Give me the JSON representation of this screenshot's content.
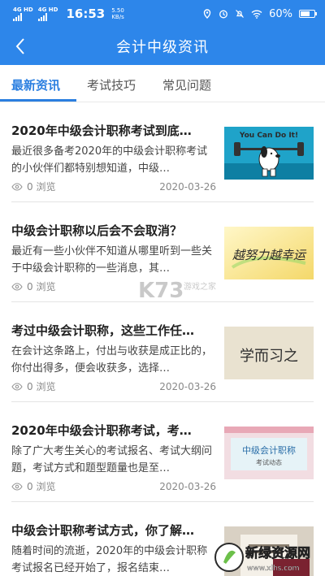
{
  "status_bar": {
    "network_1": "4G HD",
    "network_2": "4G HD",
    "time": "16:53",
    "speed_value": "5.50",
    "speed_unit": "KB/s",
    "battery": "60%"
  },
  "header": {
    "title": "会计中级资讯"
  },
  "tabs": [
    {
      "label": "最新资讯",
      "active": true
    },
    {
      "label": "考试技巧",
      "active": false
    },
    {
      "label": "常见问题",
      "active": false
    }
  ],
  "articles": [
    {
      "title": "2020年中级会计职称考试到底…",
      "desc": "最近很多备考2020年的中级会计职称考试的小伙伴们都特别想知道，中级…",
      "views": "0 浏览",
      "date": "2020-03-26",
      "thumb_icon": "snoopy-lifting-illustration",
      "thumb_text": "You Can Do It!"
    },
    {
      "title": "中级会计职称以后会不会取消？",
      "desc": "最近有一些小伙伴不知道从哪里听到一些关于中级会计职称的一些消息，其…",
      "views": "0 浏览",
      "date": "",
      "thumb_icon": "calligraphy-illustration",
      "thumb_text": "越努力越幸运"
    },
    {
      "title": "考过中级会计职称，这些工作任…",
      "desc": "在会计这条路上，付出与收获是成正比的，你付出得多，便会收获多，选择…",
      "views": "0 浏览",
      "date": "2020-03-26",
      "thumb_icon": "chalk-text-illustration",
      "thumb_text": "学而习之"
    },
    {
      "title": "2020年中级会计职称考试，考…",
      "desc": "除了广大考生关心的考试报名、考试大纲问题，考试方式和题型题量也是至…",
      "views": "0 浏览",
      "date": "2020-03-26",
      "thumb_icon": "exam-news-banner",
      "thumb_text": "中级会计职称",
      "thumb_sub": "考试动态"
    },
    {
      "title": "中级会计职称考试方式，你了解…",
      "desc": "随着时间的流逝，2020年的中级会计职称考试报名已经开始了，报名结束…",
      "views": "",
      "date": "",
      "thumb_icon": "document-illustration",
      "thumb_text": ""
    }
  ],
  "watermarks": {
    "k73_logo": "K73",
    "k73_sub": "游戏之家",
    "brand": "新绿资源网",
    "brand_url": "www.xlhs.com"
  },
  "colors": {
    "primary": "#2d86ea",
    "tab_active": "#2b7fe0"
  }
}
